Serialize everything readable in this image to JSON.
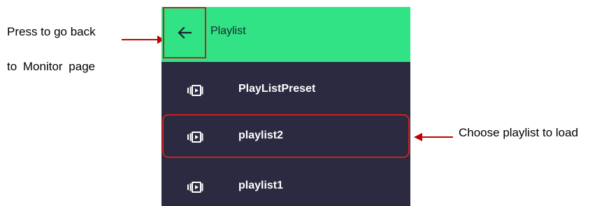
{
  "annotations": {
    "back_line1": "Press to go back",
    "back_line2": "to Monitor page",
    "choose": "Choose playlist to load"
  },
  "header": {
    "title": "Playlist",
    "back_icon": "arrow-left-icon"
  },
  "playlists": [
    {
      "label": "PlayListPreset",
      "icon": "video-reel-icon"
    },
    {
      "label": "playlist2",
      "icon": "video-reel-icon",
      "highlighted": true
    },
    {
      "label": "playlist1",
      "icon": "video-reel-icon"
    }
  ],
  "colors": {
    "header_bg": "#31e385",
    "list_bg": "#2b2a40",
    "highlight": "#c8231f"
  }
}
